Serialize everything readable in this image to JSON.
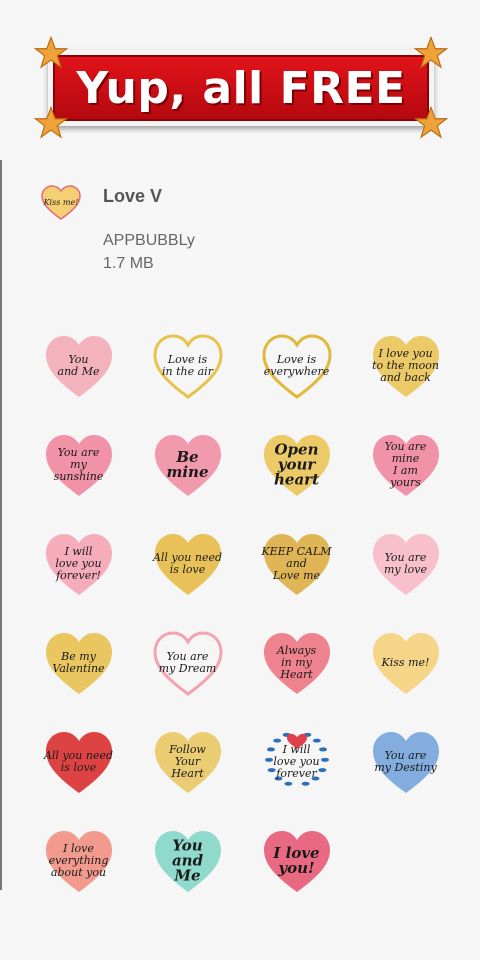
{
  "banner": {
    "text": "Yup, all FREE"
  },
  "pack": {
    "thumb_text": "Kiss me!",
    "title": "Love V",
    "author": "APPBUBBLy",
    "size": "1.7 MB"
  },
  "stickers": [
    {
      "text": "You\nand Me",
      "color": "#f2a6b2",
      "style": "fill"
    },
    {
      "text": "Love is\nin the air",
      "color": "#e8c24a",
      "style": "outline"
    },
    {
      "text": "Love is\neverywhere",
      "color": "#e0b83a",
      "style": "outline"
    },
    {
      "text": "I love you\nto the moon\nand back",
      "color": "#e9c24e",
      "style": "fill"
    },
    {
      "text": "You are\nmy\nsunshine",
      "color": "#f0809a",
      "style": "fill"
    },
    {
      "text": "Be\nmine",
      "color": "#f08aa0",
      "style": "fill",
      "big": true
    },
    {
      "text": "Open\nyour\nheart",
      "color": "#e9c24e",
      "style": "fill",
      "big": true
    },
    {
      "text": "You are\nmine\nI am\nyours",
      "color": "#f0809a",
      "style": "fill"
    },
    {
      "text": "I will\nlove you\nforever!",
      "color": "#f4a0b0",
      "style": "fill"
    },
    {
      "text": "All you need\nis love",
      "color": "#e5b93c",
      "style": "fill"
    },
    {
      "text": "KEEP CALM\nand\nLove me",
      "color": "#dba93a",
      "style": "fill"
    },
    {
      "text": "You are\nmy love",
      "color": "#f7b6c2",
      "style": "fill"
    },
    {
      "text": "Be my\nValentine",
      "color": "#e6bd45",
      "style": "fill"
    },
    {
      "text": "You are\nmy Dream",
      "color": "#f3a4b1",
      "style": "outline"
    },
    {
      "text": "Always\nin my\nHeart",
      "color": "#ec6f7a",
      "style": "fill"
    },
    {
      "text": "Kiss me!",
      "color": "#f4cf73",
      "style": "fill"
    },
    {
      "text": "All you need\nis love",
      "color": "#d92323",
      "style": "fill"
    },
    {
      "text": "Follow\nYour\nHeart",
      "color": "#e7c65a",
      "style": "fill"
    },
    {
      "text": "I will\nlove you\nforever",
      "color": "#2e6db8",
      "style": "wreath"
    },
    {
      "text": "You are\nmy Destiny",
      "color": "#6ea0db",
      "style": "fill"
    },
    {
      "text": "I love\neverything\nabout you",
      "color": "#f08a7a",
      "style": "fill"
    },
    {
      "text": "You\nand\nMe",
      "color": "#7cd4c6",
      "style": "fill",
      "big": true
    },
    {
      "text": "I love\nyou!",
      "color": "#e6506d",
      "style": "fill",
      "big": true
    }
  ],
  "colors": {
    "banner_red": "#d8101a",
    "star_orange": "#f0a23a"
  }
}
